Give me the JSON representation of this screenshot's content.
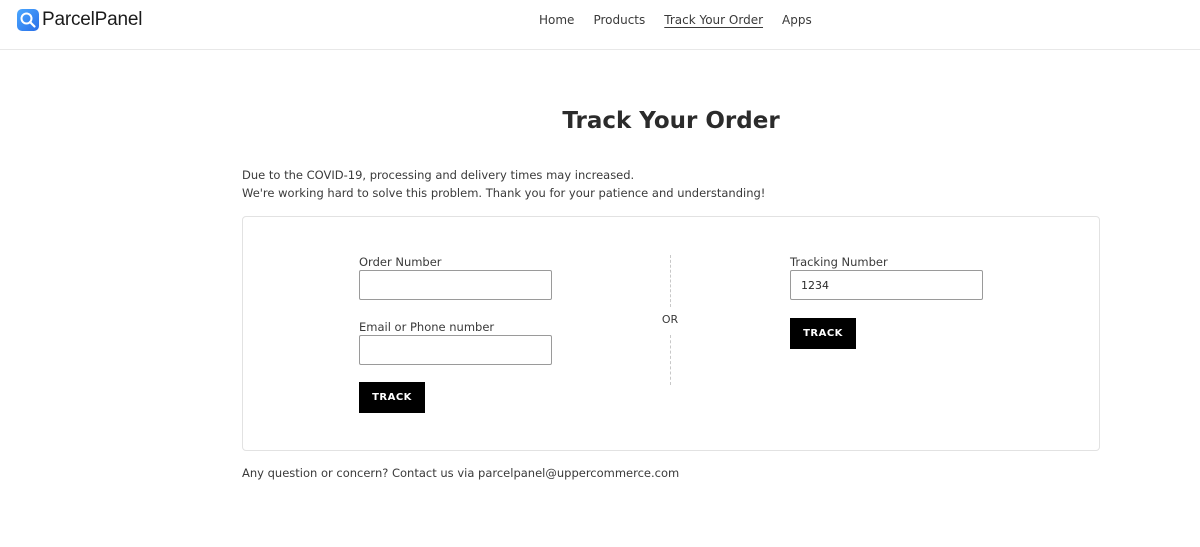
{
  "brand": {
    "name": "ParcelPanel"
  },
  "nav": {
    "items": [
      {
        "label": "Home"
      },
      {
        "label": "Products"
      },
      {
        "label": "Track Your Order"
      },
      {
        "label": "Apps"
      }
    ],
    "active_index": 2
  },
  "page": {
    "title": "Track Your Order",
    "notice_line1": "Due to the COVID-19, processing and delivery times may increased.",
    "notice_line2": "We're working hard to solve this problem. Thank you for your patience and understanding!"
  },
  "order_form": {
    "order_number_label": "Order Number",
    "order_number_value": "",
    "email_label": "Email or Phone number",
    "email_value": "",
    "button_label": "TRACK"
  },
  "divider": {
    "label": "OR"
  },
  "tracking_form": {
    "tracking_number_label": "Tracking Number",
    "tracking_number_value": "1234",
    "button_label": "TRACK"
  },
  "footer": {
    "contact_text": "Any question or concern? Contact us via parcelpanel@uppercommerce.com"
  },
  "colors": {
    "accent": "#2a6fe8",
    "button_bg": "#000000",
    "button_text": "#ffffff",
    "text": "#3a3a3a"
  },
  "icons": {
    "logo": "magnifier-logo-icon"
  }
}
